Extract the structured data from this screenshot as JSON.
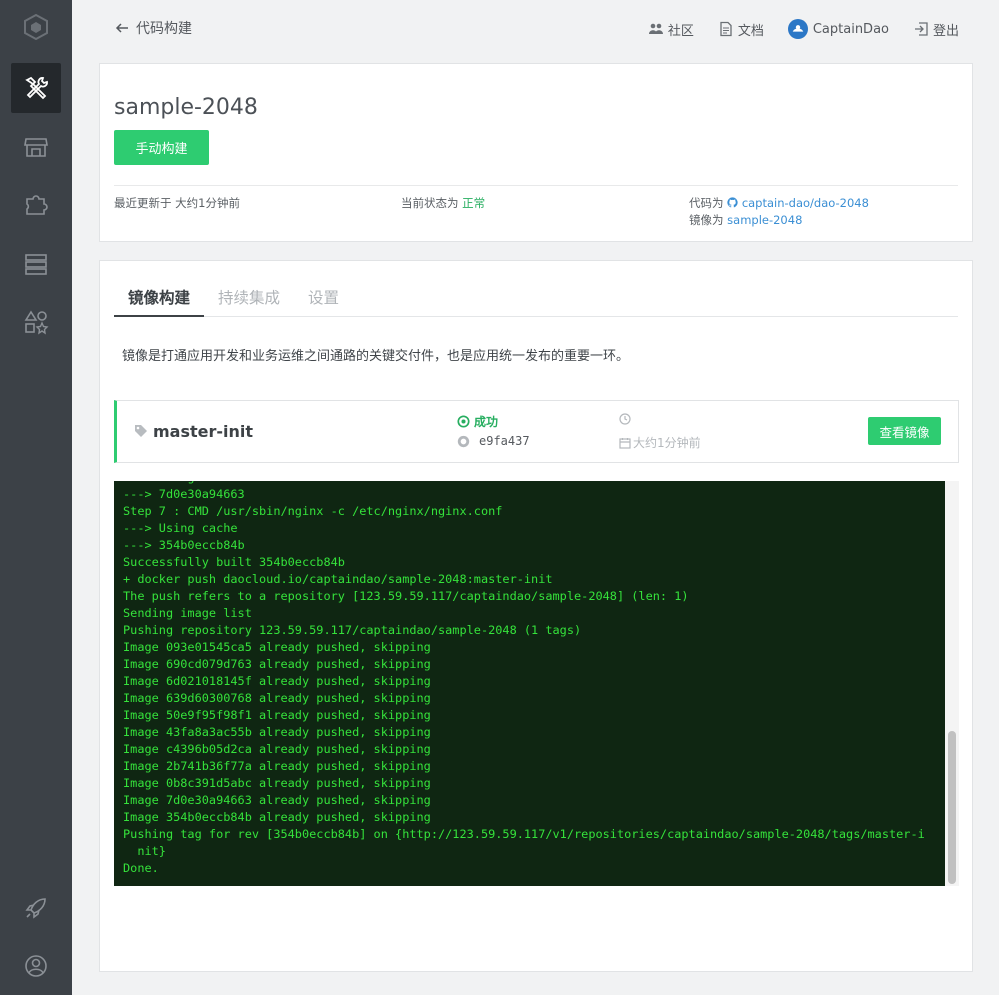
{
  "header": {
    "back_label": "代码构建",
    "nav": {
      "community": "社区",
      "docs": "文档",
      "user": "CaptainDao",
      "logout": "登出"
    }
  },
  "sidebar": {
    "items": [
      {
        "name": "logo-icon"
      },
      {
        "name": "tools-icon",
        "active": true
      },
      {
        "name": "store-icon"
      },
      {
        "name": "puzzle-icon"
      },
      {
        "name": "server-icon"
      },
      {
        "name": "shapes-icon"
      },
      {
        "name": "rocket-icon"
      },
      {
        "name": "user-icon"
      }
    ]
  },
  "app": {
    "name": "sample-2048",
    "build_button": "手动构建",
    "updated_prefix": "最近更新于",
    "updated_value": "大约1分钟前",
    "status_prefix": "当前状态为",
    "status_value": "正常",
    "code_prefix": "代码为",
    "code_value": "captain-dao/dao-2048",
    "image_prefix": "镜像为",
    "image_value": "sample-2048"
  },
  "tabs": [
    {
      "label": "镜像构建",
      "active": true
    },
    {
      "label": "持续集成",
      "active": false
    },
    {
      "label": "设置",
      "active": false
    }
  ],
  "description": "镜像是打通应用开发和业务运维之间通路的关键交付件，也是应用统一发布的重要一环。",
  "build": {
    "branch": "master-init",
    "status": "成功",
    "commit": "e9fa437",
    "time": "大约1分钟前",
    "view_button": "查看镜像"
  },
  "log_lines": [
    "---> Using cache",
    "---> 7d0e30a94663",
    "Step 7 : CMD /usr/sbin/nginx -c /etc/nginx/nginx.conf",
    "---> Using cache",
    "---> 354b0eccb84b",
    "Successfully built 354b0eccb84b",
    "+ docker push daocloud.io/captaindao/sample-2048:master-init",
    "The push refers to a repository [123.59.59.117/captaindao/sample-2048] (len: 1)",
    "Sending image list",
    "Pushing repository 123.59.59.117/captaindao/sample-2048 (1 tags)",
    "Image 093e01545ca5 already pushed, skipping",
    "Image 690cd079d763 already pushed, skipping",
    "Image 6d021018145f already pushed, skipping",
    "Image 639d60300768 already pushed, skipping",
    "Image 50e9f95f98f1 already pushed, skipping",
    "Image 43fa8a3ac55b already pushed, skipping",
    "Image c4396b05d2ca already pushed, skipping",
    "Image 2b741b36f77a already pushed, skipping",
    "Image 0b8c391d5abc already pushed, skipping",
    "Image 7d0e30a94663 already pushed, skipping",
    "Image 354b0eccb84b already pushed, skipping",
    "Pushing tag for rev [354b0eccb84b] on {http://123.59.59.117/v1/repositories/captaindao/sample-2048/tags/master-i",
    "  nit}",
    "Done."
  ],
  "colors": {
    "sidebar_bg": "#3c4147",
    "accent_green": "#2ecc71",
    "link_blue": "#3b8fd4",
    "log_bg": "#0f2612",
    "log_text": "#35e23b"
  }
}
